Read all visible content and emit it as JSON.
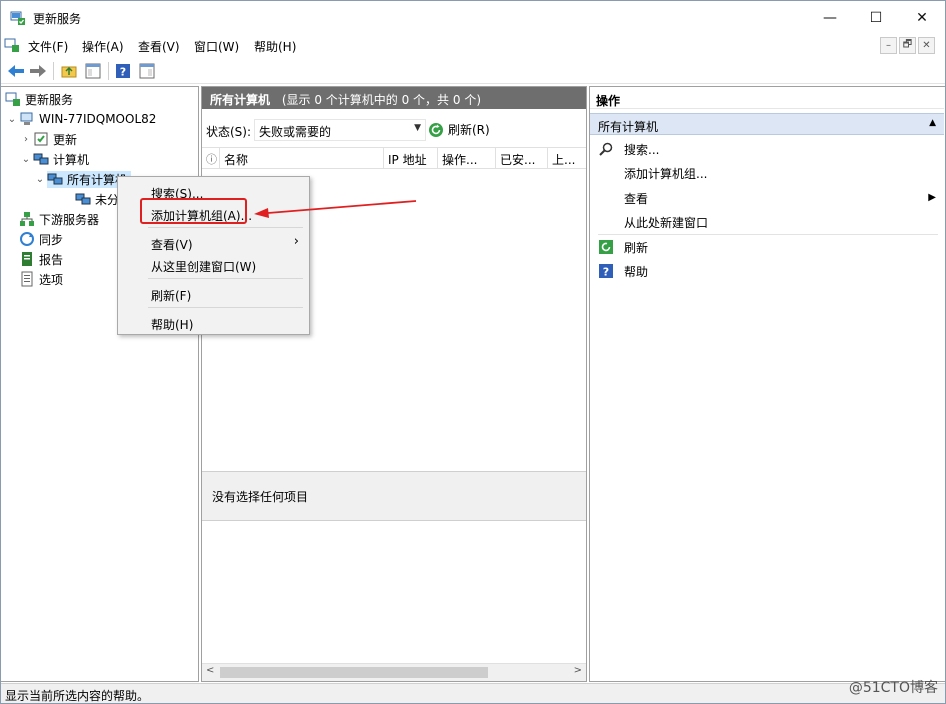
{
  "window": {
    "title": "更新服务",
    "controls": {
      "minimize": "—",
      "maximize": "☐",
      "close": "✕"
    }
  },
  "menubar": {
    "items": [
      "文件(F)",
      "操作(A)",
      "查看(V)",
      "窗口(W)",
      "帮助(H)"
    ],
    "mdi": [
      "–",
      "🗗",
      "✕"
    ]
  },
  "toolbar": {
    "icons": [
      "back-arrow-icon",
      "forward-arrow-icon",
      "folder-up-icon",
      "console-tree-icon",
      "help-icon",
      "show-action-pane-icon"
    ]
  },
  "tree": {
    "items": [
      {
        "label": "更新服务",
        "level": 0,
        "arrow": ""
      },
      {
        "label": "WIN-77IDQMOOL82",
        "level": 0,
        "arrow": "⌄"
      },
      {
        "label": "更新",
        "level": 1,
        "arrow": "›"
      },
      {
        "label": "计算机",
        "level": 1,
        "arrow": "⌄"
      },
      {
        "label": "所有计算机",
        "level": 2,
        "arrow": "⌄"
      },
      {
        "label": "未分配的计算机",
        "level": 3,
        "arrow": ""
      },
      {
        "label": "下游服务器",
        "level": 1,
        "arrow": ""
      },
      {
        "label": "同步",
        "level": 1,
        "arrow": ""
      },
      {
        "label": "报告",
        "level": 1,
        "arrow": ""
      },
      {
        "label": "选项",
        "level": 1,
        "arrow": ""
      }
    ]
  },
  "center": {
    "header_title": "所有计算机",
    "header_summary": "(显示 0 个计算机中的 0 个，共 0 个)",
    "status_label": "状态(S):",
    "status_value": "失败或需要的",
    "refresh_label": "刷新(R)",
    "columns": [
      "ⓘ",
      "名称",
      "IP 地址",
      "操作...",
      "已安...",
      "上..."
    ],
    "detail_text": "没有选择任何项目"
  },
  "actions": {
    "header": "操作",
    "section": "所有计算机",
    "items": [
      {
        "label": "搜索...",
        "icon": "search-icon"
      },
      {
        "label": "添加计算机组...",
        "icon": ""
      },
      {
        "label": "查看",
        "icon": ""
      },
      {
        "label": "从此处新建窗口",
        "icon": ""
      },
      {
        "label": "刷新",
        "icon": "refresh-icon"
      },
      {
        "label": "帮助",
        "icon": "help-icon"
      }
    ]
  },
  "context_menu": {
    "items": [
      "搜索(S)...",
      "添加计算机组(A)...",
      "查看(V)",
      "从这里创建窗口(W)",
      "刷新(F)",
      "帮助(H)"
    ],
    "submenu_arrow": "›"
  },
  "statusbar": {
    "text": "显示当前所选内容的帮助。"
  },
  "watermark": "@51CTO博客",
  "colors": {
    "accent": "#cce8ff",
    "header_gray": "#6e6e6e",
    "annotation_red": "#e02020"
  }
}
